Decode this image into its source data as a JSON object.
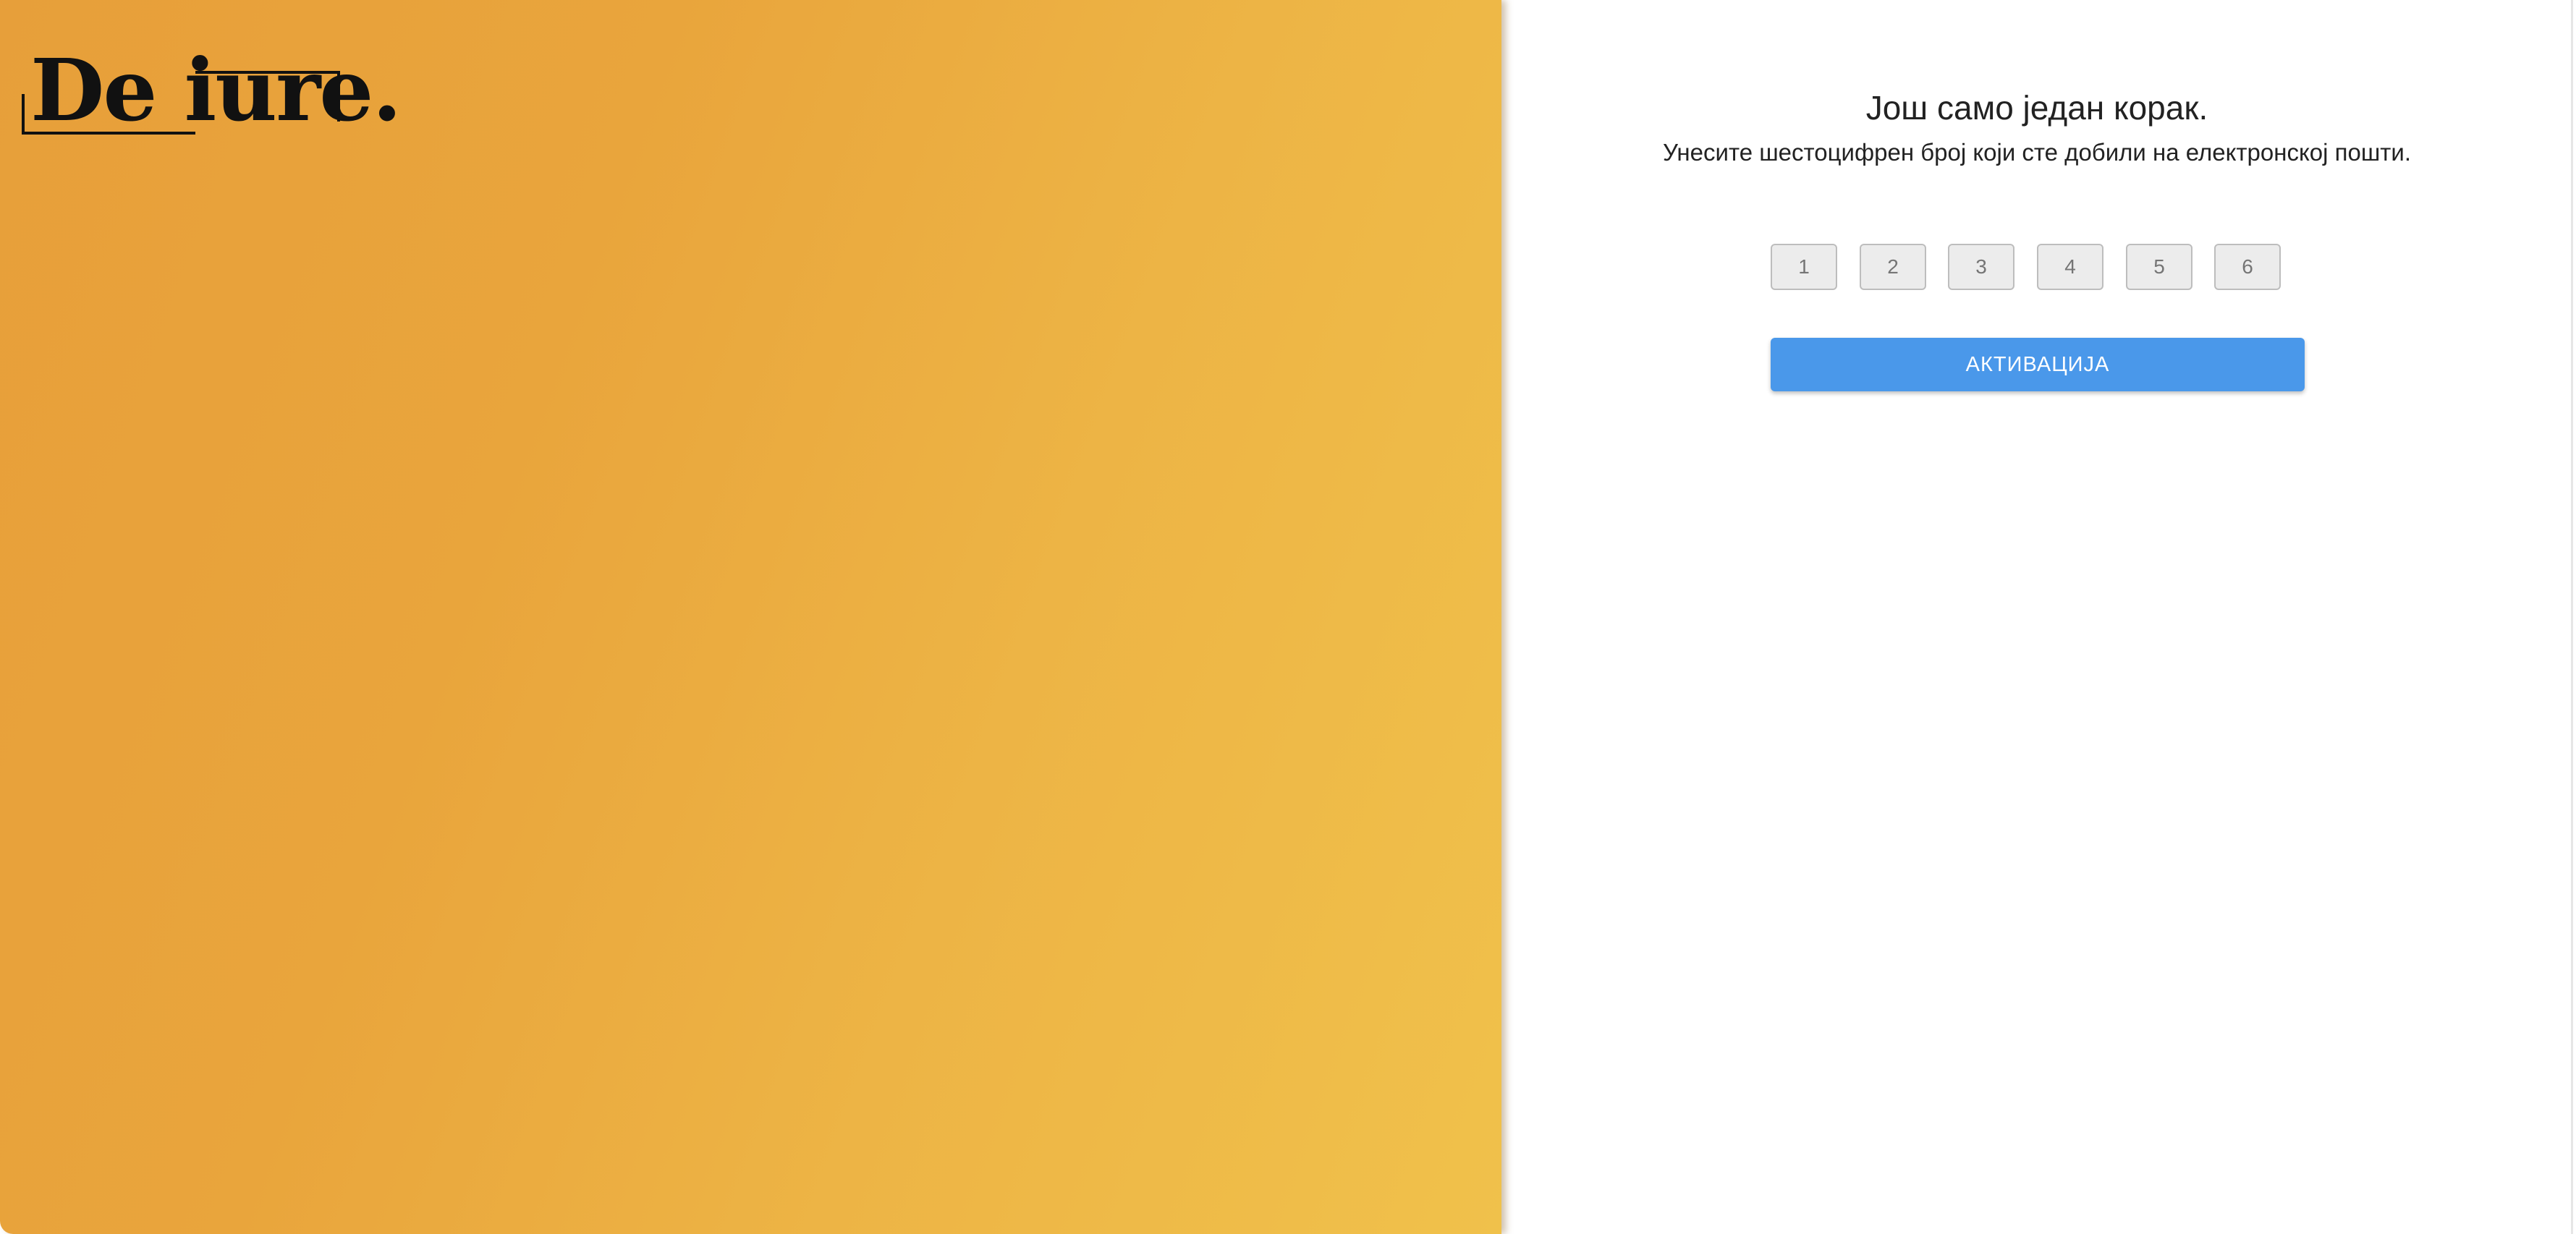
{
  "brand": {
    "logo_text": "De iure."
  },
  "verification": {
    "heading": "Још само један корак.",
    "instruction": "Унесите шестоцифрен број који сте добили на електронској пошти.",
    "code_placeholders": [
      "1",
      "2",
      "3",
      "4",
      "5",
      "6"
    ],
    "activate_label": "АКТИВАЦИЈА"
  },
  "colors": {
    "gradient_start": "#e79f3a",
    "gradient_end": "#f0c14b",
    "button_blue": "#4a98ea",
    "input_fill": "#ececec"
  }
}
